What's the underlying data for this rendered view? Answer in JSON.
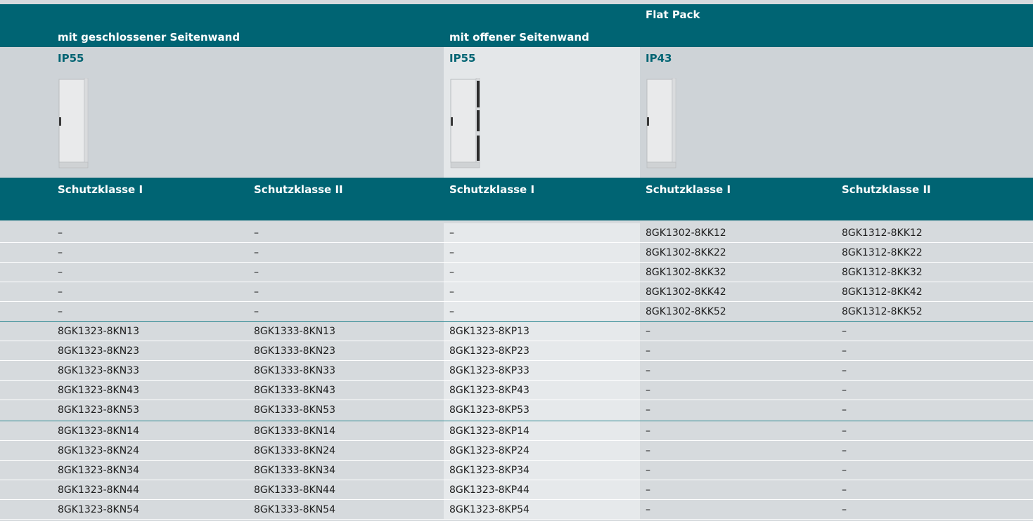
{
  "header": {
    "col_group_1": "mit geschlossener Seitenwand",
    "col_group_2": "mit offener Seitenwand",
    "col_group_3": "Flat Pack"
  },
  "protection": {
    "group_1": "IP55",
    "group_2": "IP55",
    "group_3": "IP43"
  },
  "subheader": [
    "Schutzklasse I",
    "Schutzklasse II",
    "Schutzklasse I",
    "Schutzklasse I",
    "Schutzklasse II"
  ],
  "rows": [
    [
      "–",
      "–",
      "–",
      "8GK1302-8KK12",
      "8GK1312-8KK12"
    ],
    [
      "–",
      "–",
      "–",
      "8GK1302-8KK22",
      "8GK1312-8KK22"
    ],
    [
      "–",
      "–",
      "–",
      "8GK1302-8KK32",
      "8GK1312-8KK32"
    ],
    [
      "–",
      "–",
      "–",
      "8GK1302-8KK42",
      "8GK1312-8KK42"
    ],
    [
      "–",
      "–",
      "–",
      "8GK1302-8KK52",
      "8GK1312-8KK52"
    ],
    [
      "8GK1323-8KN13",
      "8GK1333-8KN13",
      "8GK1323-8KP13",
      "–",
      "–"
    ],
    [
      "8GK1323-8KN23",
      "8GK1333-8KN23",
      "8GK1323-8KP23",
      "–",
      "–"
    ],
    [
      "8GK1323-8KN33",
      "8GK1333-8KN33",
      "8GK1323-8KP33",
      "–",
      "–"
    ],
    [
      "8GK1323-8KN43",
      "8GK1333-8KN43",
      "8GK1323-8KP43",
      "–",
      "–"
    ],
    [
      "8GK1323-8KN53",
      "8GK1333-8KN53",
      "8GK1323-8KP53",
      "–",
      "–"
    ],
    [
      "8GK1323-8KN14",
      "8GK1333-8KN14",
      "8GK1323-8KP14",
      "–",
      "–"
    ],
    [
      "8GK1323-8KN24",
      "8GK1333-8KN24",
      "8GK1323-8KP24",
      "–",
      "–"
    ],
    [
      "8GK1323-8KN34",
      "8GK1333-8KN34",
      "8GK1323-8KP34",
      "–",
      "–"
    ],
    [
      "8GK1323-8KN44",
      "8GK1333-8KN44",
      "8GK1323-8KP44",
      "–",
      "–"
    ],
    [
      "8GK1323-8KN54",
      "8GK1333-8KN54",
      "8GK1323-8KP54",
      "–",
      "–"
    ]
  ],
  "images": {
    "group_1": "closed-side-cabinet-image",
    "group_2": "open-side-cabinet-image",
    "group_3": "flat-pack-cabinet-image"
  },
  "colors": {
    "header_band": "#006473",
    "ip_text": "#006473",
    "row_bg": "#d6dadd",
    "highlight_col": "#e6e9eb"
  }
}
